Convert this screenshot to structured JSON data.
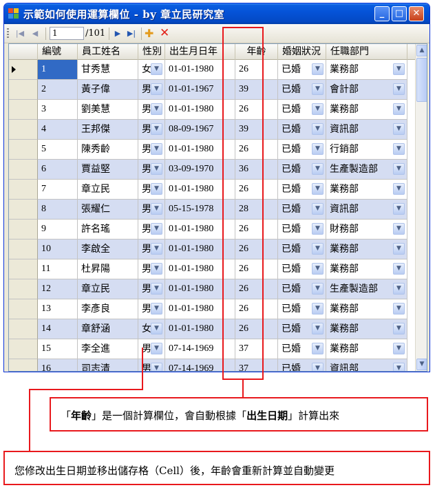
{
  "window": {
    "title": "示範如何使用運算欄位 - by 章立民研究室",
    "minimize_glyph": "_",
    "maximize_glyph": "□",
    "close_glyph": "✕"
  },
  "toolbar": {
    "position_value": "1",
    "count_label": "/101",
    "first_icon": "first-icon",
    "prev_icon": "prev-icon",
    "next_icon": "next-icon",
    "last_icon": "last-icon",
    "add_icon": "add-icon",
    "delete_icon": "delete-icon"
  },
  "grid": {
    "columns": [
      "編號",
      "員工姓名",
      "性別",
      "出生月日年",
      "年齡",
      "婚姻狀況",
      "任職部門"
    ],
    "rows": [
      [
        "1",
        "甘秀慧",
        "女",
        "01-01-1980",
        "26",
        "已婚",
        "業務部"
      ],
      [
        "2",
        "黃子偉",
        "男",
        "01-01-1967",
        "39",
        "已婚",
        "會計部"
      ],
      [
        "3",
        "劉美慧",
        "男",
        "01-01-1980",
        "26",
        "已婚",
        "業務部"
      ],
      [
        "4",
        "王邦傑",
        "男",
        "08-09-1967",
        "39",
        "已婚",
        "資訊部"
      ],
      [
        "5",
        "陳秀齡",
        "男",
        "01-01-1980",
        "26",
        "已婚",
        "行銷部"
      ],
      [
        "6",
        "賈益堅",
        "男",
        "03-09-1970",
        "36",
        "已婚",
        "生產製造部"
      ],
      [
        "7",
        "章立民",
        "男",
        "01-01-1980",
        "26",
        "已婚",
        "業務部"
      ],
      [
        "8",
        "張耀仁",
        "男",
        "05-15-1978",
        "28",
        "已婚",
        "資訊部"
      ],
      [
        "9",
        "許名瑤",
        "男",
        "01-01-1980",
        "26",
        "已婚",
        "財務部"
      ],
      [
        "10",
        "李啟全",
        "男",
        "01-01-1980",
        "26",
        "已婚",
        "業務部"
      ],
      [
        "11",
        "杜昇陽",
        "男",
        "01-01-1980",
        "26",
        "已婚",
        "業務部"
      ],
      [
        "12",
        "章立民",
        "男",
        "01-01-1980",
        "26",
        "已婚",
        "生產製造部"
      ],
      [
        "13",
        "李彥良",
        "男",
        "01-01-1980",
        "26",
        "已婚",
        "業務部"
      ],
      [
        "14",
        "章舒涵",
        "女",
        "01-01-1980",
        "26",
        "已婚",
        "業務部"
      ],
      [
        "15",
        "李全進",
        "男",
        "07-14-1969",
        "37",
        "已婚",
        "業務部"
      ],
      [
        "16",
        "司志清",
        "男",
        "07-14-1969",
        "37",
        "已婚",
        "資訊部"
      ]
    ],
    "selected_row": 0,
    "dropdown_glyph": "▼",
    "scroll_up_glyph": "▲",
    "scroll_down_glyph": "▼"
  },
  "annotations": {
    "note1_q1": "「",
    "note1_bold1": "年齡",
    "note1_q2": "」",
    "note1_mid": "是一個計算欄位，會自動根據",
    "note1_q3": "「",
    "note1_bold2": "出生日期",
    "note1_q4": "」",
    "note1_end": "計算出來",
    "note2": "您修改出生日期並移出儲存格（Cell）後，年齡會重新計算並自動變更"
  },
  "colors": {
    "accent_red": "#e8181c",
    "selected_row": "#316ac5",
    "alt_row": "#d5ddf2",
    "titlebar": "#0553d8"
  }
}
